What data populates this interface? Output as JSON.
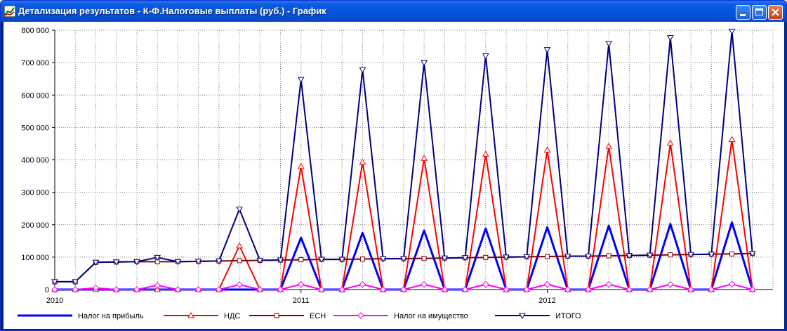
{
  "window": {
    "title": "Детализация результатов - К-Ф.Налоговые выплаты (руб.) - График"
  },
  "chart_data": {
    "type": "line",
    "ylim": [
      0,
      800000
    ],
    "y_tick_labels": [
      "0",
      "100 000",
      "200 000",
      "300 000",
      "400 000",
      "500 000",
      "600 000",
      "700 000",
      "800 000"
    ],
    "x_tick_labels": [
      {
        "label": "2010",
        "period": 0
      },
      {
        "label": "2011",
        "period": 12
      },
      {
        "label": "2012",
        "period": 24
      }
    ],
    "grid": true,
    "legend_position": "bottom",
    "series": [
      {
        "name": "Налог на прибыль",
        "color": "#0000FF",
        "marker": "none",
        "values": [
          0,
          0,
          0,
          0,
          0,
          0,
          0,
          0,
          0,
          0,
          0,
          0,
          160000,
          0,
          0,
          175000,
          0,
          0,
          182000,
          0,
          0,
          188000,
          0,
          0,
          192000,
          0,
          0,
          197000,
          0,
          0,
          202000,
          0,
          0,
          207000,
          0
        ]
      },
      {
        "name": "НДС",
        "color": "#FF0000",
        "marker": "triangle-up",
        "values": [
          0,
          0,
          0,
          0,
          0,
          0,
          0,
          0,
          0,
          135000,
          0,
          0,
          380000,
          0,
          0,
          393000,
          0,
          0,
          405000,
          0,
          0,
          418000,
          0,
          0,
          430000,
          0,
          0,
          442000,
          0,
          0,
          452000,
          0,
          0,
          463000,
          0
        ]
      },
      {
        "name": "ЕСН",
        "color": "#800000",
        "marker": "square",
        "values": [
          24000,
          24000,
          84000,
          85000,
          86000,
          86000,
          86000,
          87000,
          88000,
          89000,
          90000,
          91000,
          92000,
          93000,
          93000,
          94000,
          95000,
          95000,
          96000,
          97000,
          98000,
          99000,
          100000,
          101000,
          102000,
          103000,
          103000,
          104000,
          105000,
          106000,
          107000,
          108000,
          109000,
          110000,
          111000
        ]
      },
      {
        "name": "Налог на имущество",
        "color": "#FF00FF",
        "marker": "diamond",
        "values": [
          0,
          0,
          5000,
          0,
          0,
          13000,
          0,
          0,
          0,
          15000,
          0,
          0,
          16000,
          0,
          0,
          16000,
          0,
          0,
          16000,
          0,
          0,
          16000,
          0,
          0,
          16000,
          0,
          0,
          16000,
          0,
          0,
          16000,
          0,
          0,
          17000,
          0
        ]
      },
      {
        "name": "ИТОГО",
        "color": "#000080",
        "marker": "triangle-down",
        "values": [
          24000,
          24000,
          84000,
          85000,
          86000,
          99000,
          86000,
          87000,
          88000,
          248000,
          90000,
          91000,
          648000,
          93000,
          93000,
          678000,
          95000,
          95000,
          700000,
          97000,
          98000,
          721000,
          100000,
          101000,
          740000,
          103000,
          103000,
          759000,
          105000,
          106000,
          777000,
          108000,
          109000,
          797000,
          111000
        ]
      }
    ]
  }
}
